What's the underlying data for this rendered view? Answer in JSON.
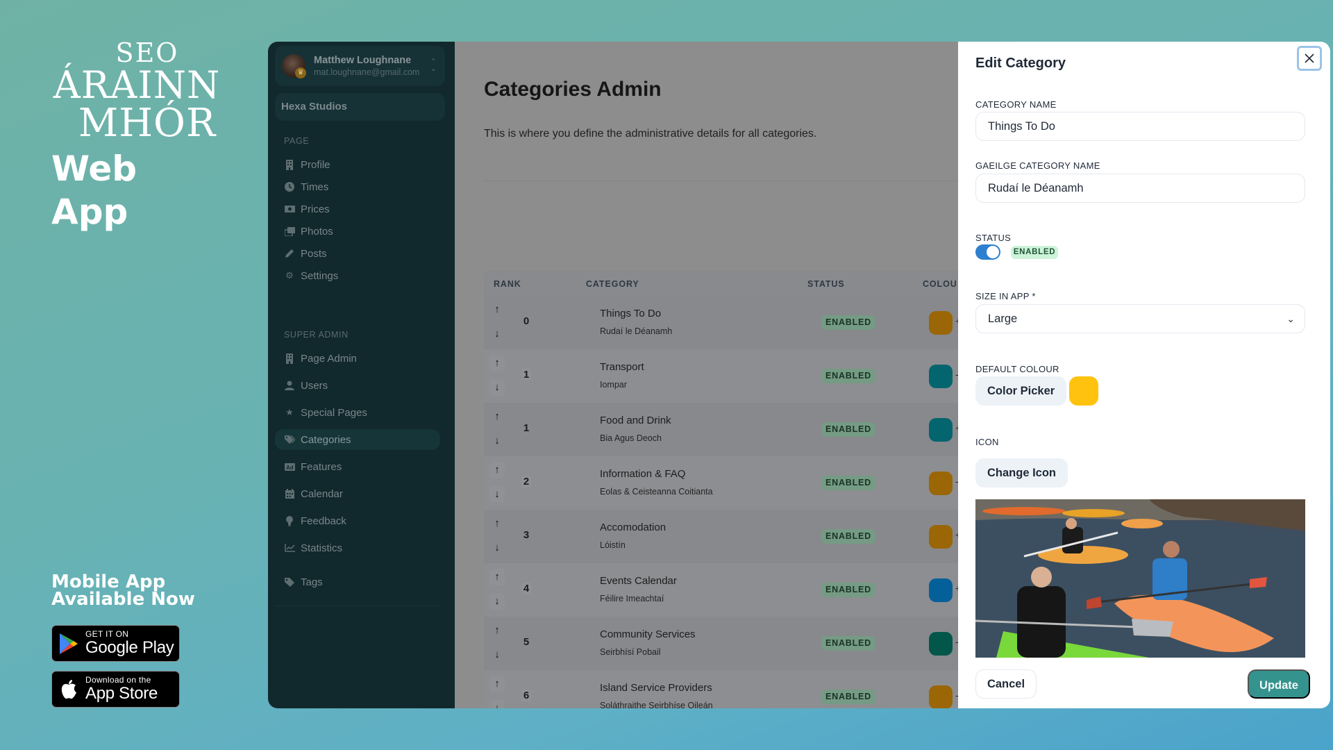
{
  "branding": {
    "logo_line1": "SEO",
    "logo_line2": "ÁRAINN",
    "logo_line3": "MHÓR",
    "subtitle": "Web App",
    "mobile_line1": "Mobile App",
    "mobile_line2": "Available Now",
    "google_play": {
      "small": "GET IT ON",
      "big": "Google Play"
    },
    "app_store": {
      "small": "Download on the",
      "big": "App Store"
    }
  },
  "sidebar": {
    "user": {
      "name": "Matthew Loughnane",
      "email": "mat.loughnane@gmail.com"
    },
    "organization": "Hexa Studios",
    "sections": [
      {
        "label": "PAGE",
        "items": [
          {
            "label": "Profile",
            "icon": "building-icon"
          },
          {
            "label": "Times",
            "icon": "clock-icon"
          },
          {
            "label": "Prices",
            "icon": "money-icon"
          },
          {
            "label": "Photos",
            "icon": "photos-icon"
          },
          {
            "label": "Posts",
            "icon": "pencil-icon"
          },
          {
            "label": "Settings",
            "icon": "gear-icon"
          }
        ]
      },
      {
        "label": "SUPER ADMIN",
        "items": [
          {
            "label": "Page Admin",
            "icon": "building-icon"
          },
          {
            "label": "Users",
            "icon": "user-icon"
          },
          {
            "label": "Special Pages",
            "icon": "star-icon"
          },
          {
            "label": "Categories",
            "icon": "tags-icon",
            "active": true
          },
          {
            "label": "Features",
            "icon": "ad-icon"
          },
          {
            "label": "Calendar",
            "icon": "calendar-icon"
          },
          {
            "label": "Feedback",
            "icon": "lightbulb-icon"
          },
          {
            "label": "Statistics",
            "icon": "chart-line-icon"
          }
        ]
      }
    ],
    "footer_items": [
      {
        "label": "Tags",
        "icon": "tag-icon"
      }
    ]
  },
  "main": {
    "title": "Categories Admin",
    "description": "This is where you define the administrative details for all categories.",
    "table": {
      "headers": {
        "rank": "RANK",
        "category": "CATEGORY",
        "status": "STATUS",
        "colour": "COLOU"
      },
      "rows": [
        {
          "rank": "0",
          "name": "Things To Do",
          "gaeilge": "Rudaí le Déanamh",
          "status": "ENABLED",
          "colour": "#9a6606",
          "suffix": "+"
        },
        {
          "rank": "1",
          "name": "Transport",
          "gaeilge": "Iompar",
          "status": "ENABLED",
          "colour": "#05656f",
          "suffix": "-"
        },
        {
          "rank": "1",
          "name": "Food and Drink",
          "gaeilge": "Bia Agus Deoch",
          "status": "ENABLED",
          "colour": "#05656f",
          "suffix": "+"
        },
        {
          "rank": "2",
          "name": "Information & FAQ",
          "gaeilge": "Eolas & Ceisteanna Coitianta",
          "status": "ENABLED",
          "colour": "#9a6606",
          "suffix": "-"
        },
        {
          "rank": "3",
          "name": "Accomodation",
          "gaeilge": "Lóistín",
          "status": "ENABLED",
          "colour": "#9a6606",
          "suffix": "+"
        },
        {
          "rank": "4",
          "name": "Events Calendar",
          "gaeilge": "Féilire Imeachtaí",
          "status": "ENABLED",
          "colour": "#05609a",
          "suffix": "+"
        },
        {
          "rank": "5",
          "name": "Community Services",
          "gaeilge": "Seirbhísí Pobail",
          "status": "ENABLED",
          "colour": "#03574a",
          "suffix": "-"
        },
        {
          "rank": "6",
          "name": "Island Service Providers",
          "gaeilge": "Soláthraithe Seirbhíse Oileán",
          "status": "ENABLED",
          "colour": "#9a6606",
          "suffix": "-"
        }
      ]
    }
  },
  "modal": {
    "title": "Edit Category",
    "category_name_label": "CATEGORY NAME",
    "category_name_value": "Things To Do",
    "gaeilge_label": "GAEILGE CATEGORY NAME",
    "gaeilge_value": "Rudaí le Déanamh",
    "status_label": "STATUS",
    "status_enabled": true,
    "status_badge": "ENABLED",
    "size_label": "SIZE IN APP *",
    "size_value": "Large",
    "colour_label": "DEFAULT COLOUR",
    "color_picker_label": "Color Picker",
    "default_colour": "#ffc20e",
    "icon_label": "ICON",
    "change_icon_label": "Change Icon",
    "cancel_label": "Cancel",
    "update_label": "Update"
  }
}
